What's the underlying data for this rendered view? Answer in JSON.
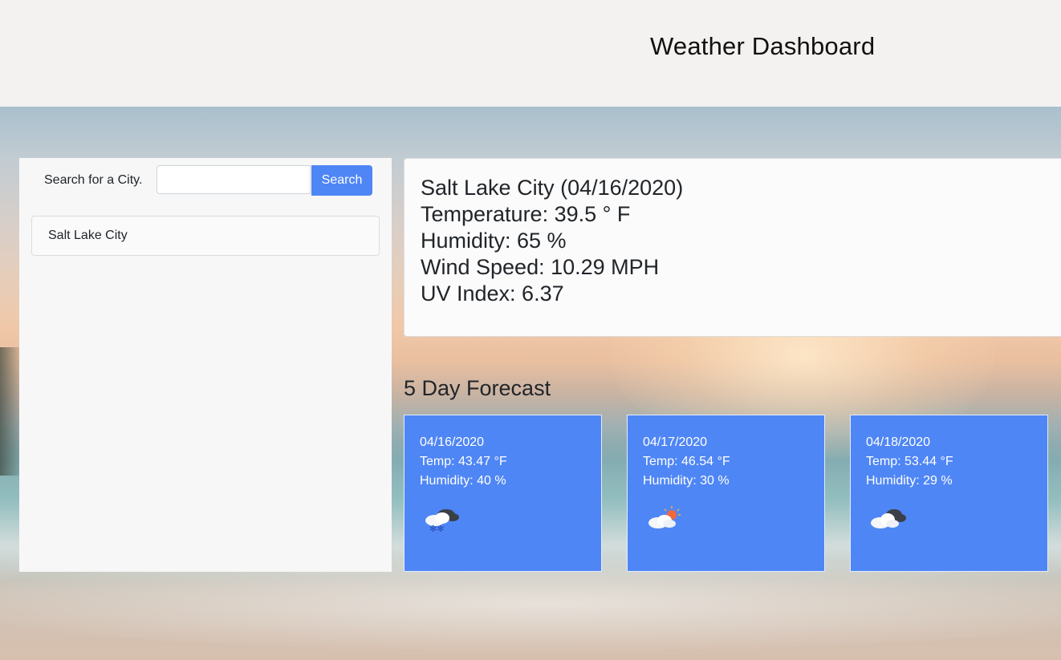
{
  "header": {
    "title": "Weather Dashboard"
  },
  "search": {
    "label": "Search for a City.",
    "value": "",
    "placeholder": "",
    "button_label": "Search"
  },
  "history": {
    "cities": [
      "Salt Lake City"
    ]
  },
  "current": {
    "city_line": "Salt Lake City (04/16/2020)",
    "temperature_line": "Temperature: 39.5 ° F",
    "humidity_line": "Humidity: 65 %",
    "wind_line": "Wind Speed: 10.29 MPH",
    "uv_line": "UV Index: 6.37"
  },
  "forecast": {
    "title": "5 Day Forecast",
    "days": [
      {
        "date": "04/16/2020",
        "temp": "Temp: 43.47 °F",
        "humidity": "Humidity: 40 %",
        "icon": "snow-cloud-icon"
      },
      {
        "date": "04/17/2020",
        "temp": "Temp: 46.54 °F",
        "humidity": "Humidity: 30 %",
        "icon": "partly-sunny-icon"
      },
      {
        "date": "04/18/2020",
        "temp": "Temp: 53.44 °F",
        "humidity": "Humidity: 29 %",
        "icon": "cloudy-icon"
      }
    ]
  },
  "colors": {
    "accent": "#4f86f5",
    "header_bg": "#f3f2f0",
    "panel_bg": "#f7f7f7"
  }
}
